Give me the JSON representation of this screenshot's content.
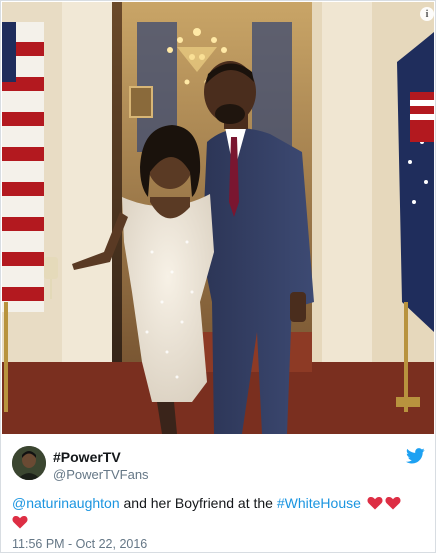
{
  "media": {
    "description_icon": "info-icon",
    "info_label": "i"
  },
  "author": {
    "display_name": "#PowerTV",
    "handle": "@PowerTVFans",
    "avatar_icon": "avatar-image"
  },
  "platform_icon": "twitter-bird-icon",
  "tweet": {
    "mention": "@naturinaughton",
    "text_middle": " and her Boyfriend at the ",
    "hashtag": "#WhiteHouse",
    "emoji": [
      "heart-icon",
      "heart-icon",
      "heart-icon"
    ],
    "heart_color": "#dd2e44"
  },
  "timestamp": "11:56 PM - Oct 22, 2016",
  "colors": {
    "link": "#1b95e0",
    "secondary_text": "#657786",
    "twitter_blue": "#1da1f2"
  }
}
